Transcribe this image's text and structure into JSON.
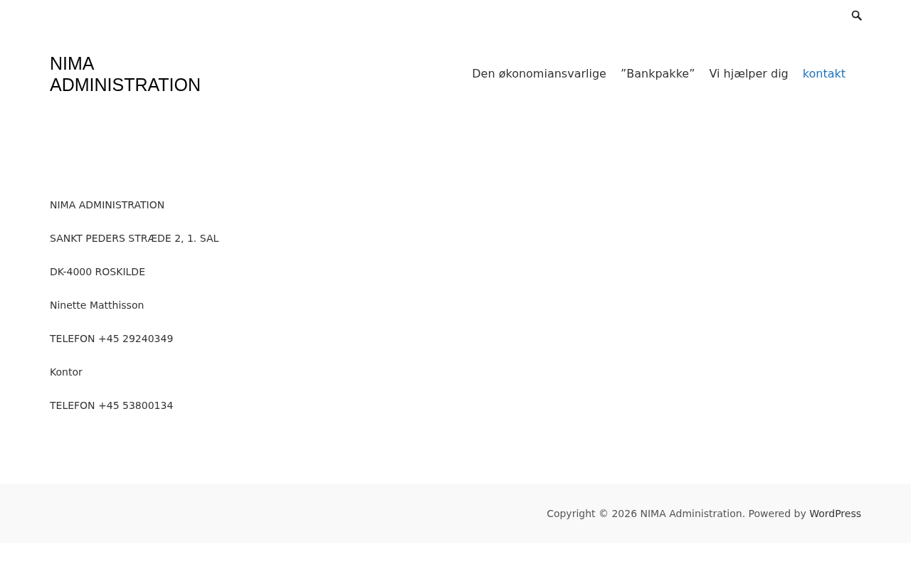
{
  "site_title": "NIMA ADMINISTRATION",
  "nav": [
    {
      "label": "Den økonomiansvarlige",
      "selected": false
    },
    {
      "label": "”Bankpakke”",
      "selected": false
    },
    {
      "label": "Vi hjælper dig",
      "selected": false
    },
    {
      "label": "kontakt",
      "selected": true
    }
  ],
  "content": [
    "NIMA ADMINISTRATION",
    "SANKT PEDERS STRÆDE 2, 1. SAL",
    "DK-4000 ROSKILDE",
    "Ninette Matthisson",
    "TELEFON +45 29240349",
    "Kontor",
    "TELEFON +45 53800134"
  ],
  "footer": {
    "text": "Copyright © 2026 NIMA Administration. Powered by",
    "link": "WordPress"
  }
}
